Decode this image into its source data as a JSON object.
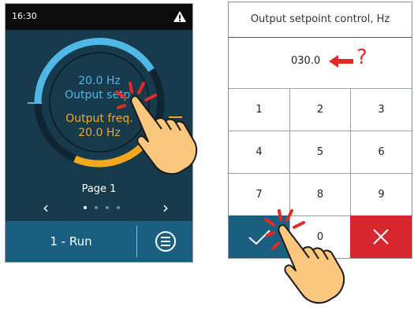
{
  "left_device": {
    "status_bar": {
      "time": "16:30",
      "icon": "warning-icon"
    },
    "gauge": {
      "setpoint_value": "20.0 Hz",
      "setpoint_label": "Output setp.",
      "freq_label": "Output freq.",
      "freq_value": "20.0 Hz"
    },
    "page_label": "Page 1",
    "pager": {
      "current": 1,
      "total": 4
    },
    "run_button": "1 - Run",
    "menu_icon": "menu-icon"
  },
  "right_device": {
    "title": "Output setpoint control, Hz",
    "value": "030.0",
    "annotation": "?",
    "keys": [
      "1",
      "2",
      "3",
      "4",
      "5",
      "6",
      "7",
      "8",
      "9",
      "✓",
      "0",
      "✕"
    ]
  },
  "colors": {
    "screen_bg": "#173a4d",
    "blue_accent": "#50b8e6",
    "orange_accent": "#f5a81d",
    "button_blue": "#1b5f80",
    "cancel_red": "#d7262d",
    "annotation_red": "#e32b24",
    "hand_skin": "#fbc77e"
  }
}
